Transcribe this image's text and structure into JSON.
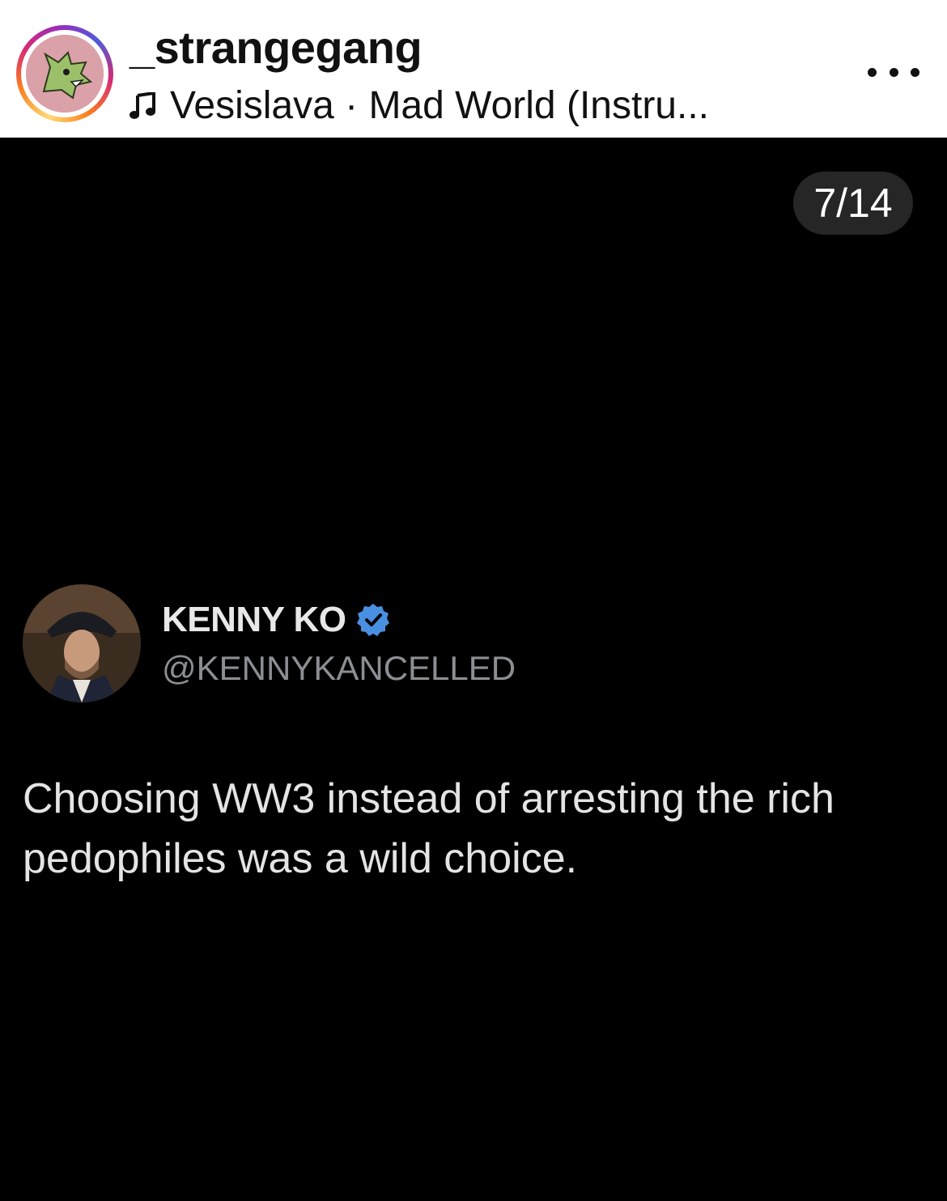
{
  "post_header": {
    "username": "_strangegang",
    "audio": "Vesislava · Mad World (Instru...",
    "audio_icon": "music-note-icon",
    "more_icon": "more-options-icon"
  },
  "carousel": {
    "counter": "7/14"
  },
  "tweet": {
    "display_name": "KENNY KO",
    "verified": true,
    "verified_color": "#4a90e2",
    "handle": "@KENNYKANCELLED",
    "text": "Choosing WW3 instead of arresting the rich pedophiles was a wild choice."
  },
  "colors": {
    "header_bg": "#ffffff",
    "media_bg": "#000000",
    "story_ring": [
      "#feda75",
      "#fa7e1e",
      "#d62976",
      "#962fbf"
    ],
    "avatar_bg": "#dba1a8"
  }
}
